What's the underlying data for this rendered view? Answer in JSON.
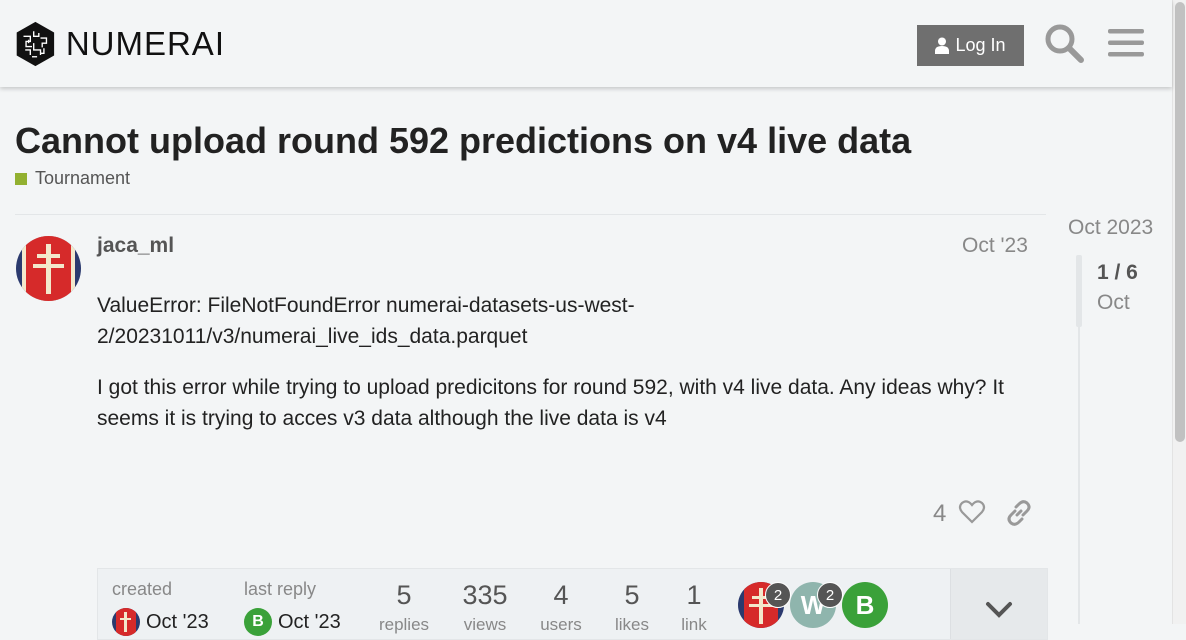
{
  "header": {
    "logo_text": "NUMERAI",
    "login_label": "Log In",
    "icons": [
      "user-icon",
      "search-icon",
      "hamburger-menu-icon"
    ]
  },
  "topic": {
    "title": "Cannot upload round 592 predictions on v4 live data",
    "category": "Tournament",
    "category_color": "#92b030"
  },
  "post": {
    "username": "jaca_ml",
    "date": "Oct '23",
    "paragraphs": [
      "ValueError: FileNotFoundError numerai-datasets-us-west-2/20231011/v3/numerai_live_ids_data.parquet",
      "I got this error while trying to upload predicitons for round 592, with v4 live data. Any ideas why? It seems it is trying to acces v3 data although the live data is v4"
    ],
    "likes": "4"
  },
  "topic_map": {
    "created_label": "created",
    "created_date": "Oct '23",
    "last_reply_label": "last reply",
    "last_reply_date": "Oct '23",
    "last_reply_avatar_letter": "B",
    "stats": [
      {
        "num": "5",
        "label": "replies"
      },
      {
        "num": "335",
        "label": "views"
      },
      {
        "num": "4",
        "label": "users"
      },
      {
        "num": "5",
        "label": "likes"
      },
      {
        "num": "1",
        "label": "link"
      }
    ],
    "participants": [
      {
        "letter": "",
        "count": "2"
      },
      {
        "letter": "W",
        "count": "2"
      },
      {
        "letter": "B",
        "count": ""
      }
    ]
  },
  "timeline": {
    "top_date": "Oct 2023",
    "position": "1 / 6",
    "current_date": "Oct"
  },
  "colors": {
    "login_button": "#6f6f6f",
    "participant_w": "#8fb5ad",
    "participant_b": "#3aa139"
  }
}
